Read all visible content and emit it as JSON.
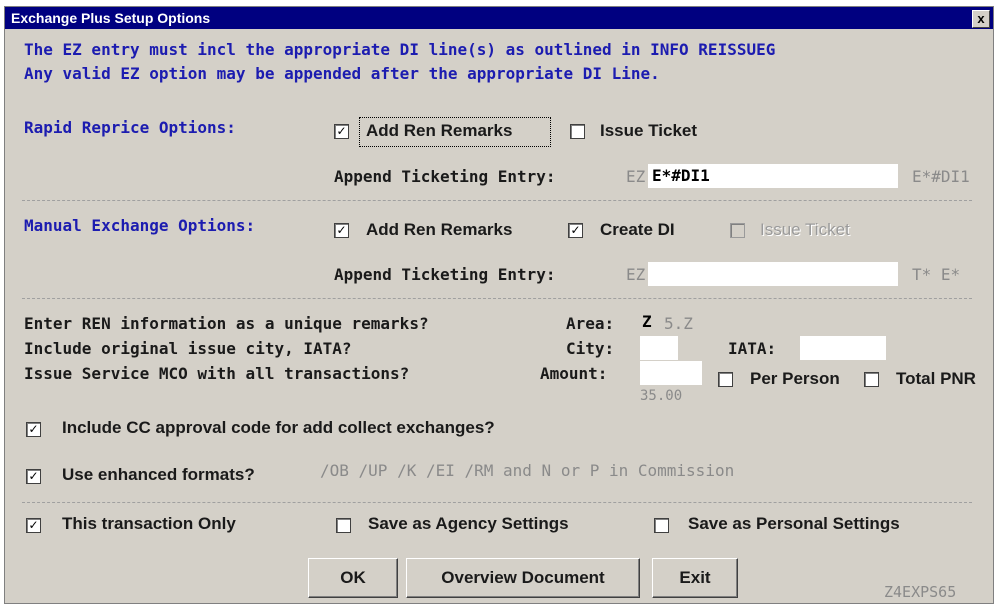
{
  "window": {
    "title": "Exchange Plus Setup Options",
    "close_glyph": "x"
  },
  "info": {
    "line1": "The EZ entry must incl the appropriate DI line(s) as outlined in INFO REISSUEG",
    "line2": "Any valid EZ option may be appended after the appropriate DI Line."
  },
  "rapid": {
    "label": "Rapid Reprice Options:",
    "add_ren_label": "Add Ren Remarks",
    "add_ren_checked": true,
    "issue_ticket_label": "Issue Ticket",
    "issue_ticket_checked": false,
    "append_label": "Append Ticketing Entry:",
    "prefix": "EZ",
    "entry_value": "E*#DI1",
    "hint": "E*#DI1"
  },
  "manual": {
    "label": "Manual Exchange Options:",
    "add_ren_label": "Add Ren Remarks",
    "add_ren_checked": true,
    "create_di_label": "Create DI",
    "create_di_checked": true,
    "issue_ticket_label": "Issue Ticket",
    "issue_ticket_checked": false,
    "append_label": "Append Ticketing Entry:",
    "prefix": "EZ",
    "entry_value": "",
    "hint": "T* E*"
  },
  "ren": {
    "q1": "Enter REN information as a unique remarks?",
    "area_label": "Area:",
    "area_value": "Z",
    "area_hint": "5.Z",
    "q2": "Include original issue city, IATA?",
    "city_label": "City:",
    "city_value": "",
    "iata_label": "IATA:",
    "iata_value": "",
    "q3": "Issue Service MCO with all transactions?",
    "amount_label": "Amount:",
    "amount_value": "",
    "amount_hint": "35.00",
    "per_person_label": "Per Person",
    "per_person_checked": false,
    "total_pnr_label": "Total PNR",
    "total_pnr_checked": false
  },
  "cc": {
    "label": "Include CC approval code for add collect exchanges?",
    "checked": true
  },
  "enhanced": {
    "label": "Use enhanced formats?",
    "checked": true,
    "hint": "/OB /UP /K /EI /RM and N or P in Commission"
  },
  "scope": {
    "this_only_label": "This transaction Only",
    "this_only_checked": true,
    "agency_label": "Save as Agency Settings",
    "agency_checked": false,
    "personal_label": "Save as Personal Settings",
    "personal_checked": false
  },
  "buttons": {
    "ok": "OK",
    "overview": "Overview Document",
    "exit": "Exit"
  },
  "form_id": "Z4EXPS65",
  "check_glyph": "✓"
}
